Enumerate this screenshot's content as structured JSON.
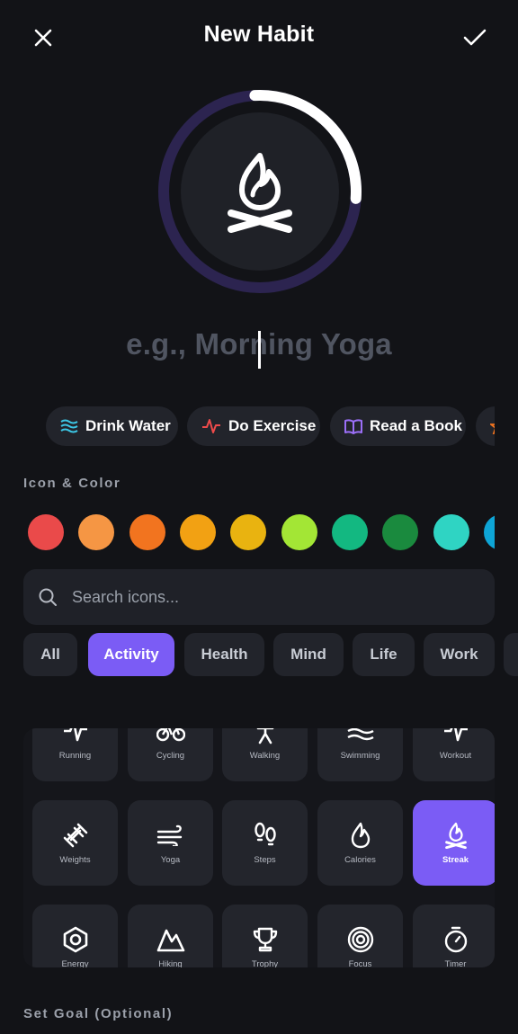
{
  "header": {
    "title": "New Habit",
    "close_icon": "close-icon",
    "confirm_icon": "check-icon"
  },
  "preview": {
    "icon": "campfire-icon",
    "progress": 0.27,
    "ring_color": "#2c2450",
    "arc_color": "#ffffff"
  },
  "name_input": {
    "placeholder": "e.g., Morning Yoga",
    "value": ""
  },
  "suggestions": [
    {
      "label": "Drink Water",
      "icon": "waves-icon",
      "color": "#3cc6e4"
    },
    {
      "label": "Do Exercise",
      "icon": "pulse-icon",
      "color": "#ef4b4b"
    },
    {
      "label": "Read a Book",
      "icon": "book-icon",
      "color": "#9b6ff7"
    }
  ],
  "icon_color": {
    "label": "Icon & Color",
    "colors": [
      "#ea4a4a",
      "#f59644",
      "#f2741f",
      "#f2a113",
      "#e9b310",
      "#a3e635",
      "#13b881",
      "#1a8a3e",
      "#2fd4c3",
      "#0ea5d6"
    ]
  },
  "search": {
    "placeholder": "Search icons..."
  },
  "categories": {
    "items": [
      "All",
      "Activity",
      "Health",
      "Mind",
      "Life",
      "Work"
    ],
    "active": "Activity"
  },
  "icons": [
    {
      "label": "Running",
      "icon": "running-icon"
    },
    {
      "label": "Cycling",
      "icon": "bicycle-icon"
    },
    {
      "label": "Walking",
      "icon": "walking-icon"
    },
    {
      "label": "Swimming",
      "icon": "waves-icon"
    },
    {
      "label": "Workout",
      "icon": "pulse-icon"
    },
    {
      "label": "Weights",
      "icon": "dumbbell-icon"
    },
    {
      "label": "Yoga",
      "icon": "wind-icon"
    },
    {
      "label": "Steps",
      "icon": "footprints-icon"
    },
    {
      "label": "Calories",
      "icon": "flame-icon"
    },
    {
      "label": "Streak",
      "icon": "campfire-icon",
      "selected": true
    },
    {
      "label": "Energy",
      "icon": "hexagon-icon"
    },
    {
      "label": "Hiking",
      "icon": "mountain-icon"
    },
    {
      "label": "Trophy",
      "icon": "trophy-icon"
    },
    {
      "label": "Focus",
      "icon": "target-icon"
    },
    {
      "label": "Timer",
      "icon": "timer-icon"
    }
  ],
  "goal": {
    "label": "Set Goal (Optional)"
  }
}
